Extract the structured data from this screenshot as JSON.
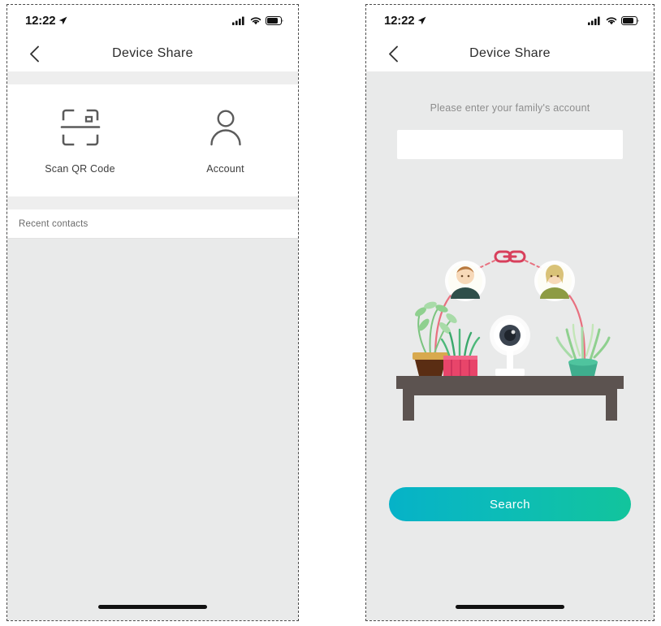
{
  "status_bar": {
    "time": "12:22",
    "location_icon": "location-arrow-icon",
    "signal_icon": "cellular-signal-icon",
    "wifi_icon": "wifi-icon",
    "battery_icon": "battery-icon"
  },
  "nav": {
    "back_icon": "chevron-left-icon",
    "title": "Device Share"
  },
  "left_screen": {
    "options": [
      {
        "label": "Scan QR Code",
        "icon": "qr-scan-icon"
      },
      {
        "label": "Account",
        "icon": "person-icon"
      }
    ],
    "recent_contacts_label": "Recent contacts"
  },
  "right_screen": {
    "prompt": "Please enter your family's account",
    "input_value": "",
    "input_placeholder": "",
    "search_button_label": "Search",
    "illustration": {
      "name": "device-sharing-illustration",
      "camera_icon": "security-camera-icon",
      "link_icon": "chain-link-icon",
      "avatar_left": "user-avatar-male",
      "avatar_right": "user-avatar-female",
      "plants": [
        "potted-palm-plant",
        "pink-pot-grass-plant",
        "succulent-plant"
      ],
      "table": "wooden-table"
    }
  },
  "colors": {
    "accent_start": "#06b2c8",
    "accent_end": "#12c49c",
    "screen_bg": "#e9eaea",
    "card_bg": "#ffffff",
    "link_pink": "#e8566d",
    "table_brown": "#5c5350",
    "pot_brown": "#5a2d13",
    "pot_pink": "#e8456a",
    "plant_green": "#7bc47f"
  }
}
